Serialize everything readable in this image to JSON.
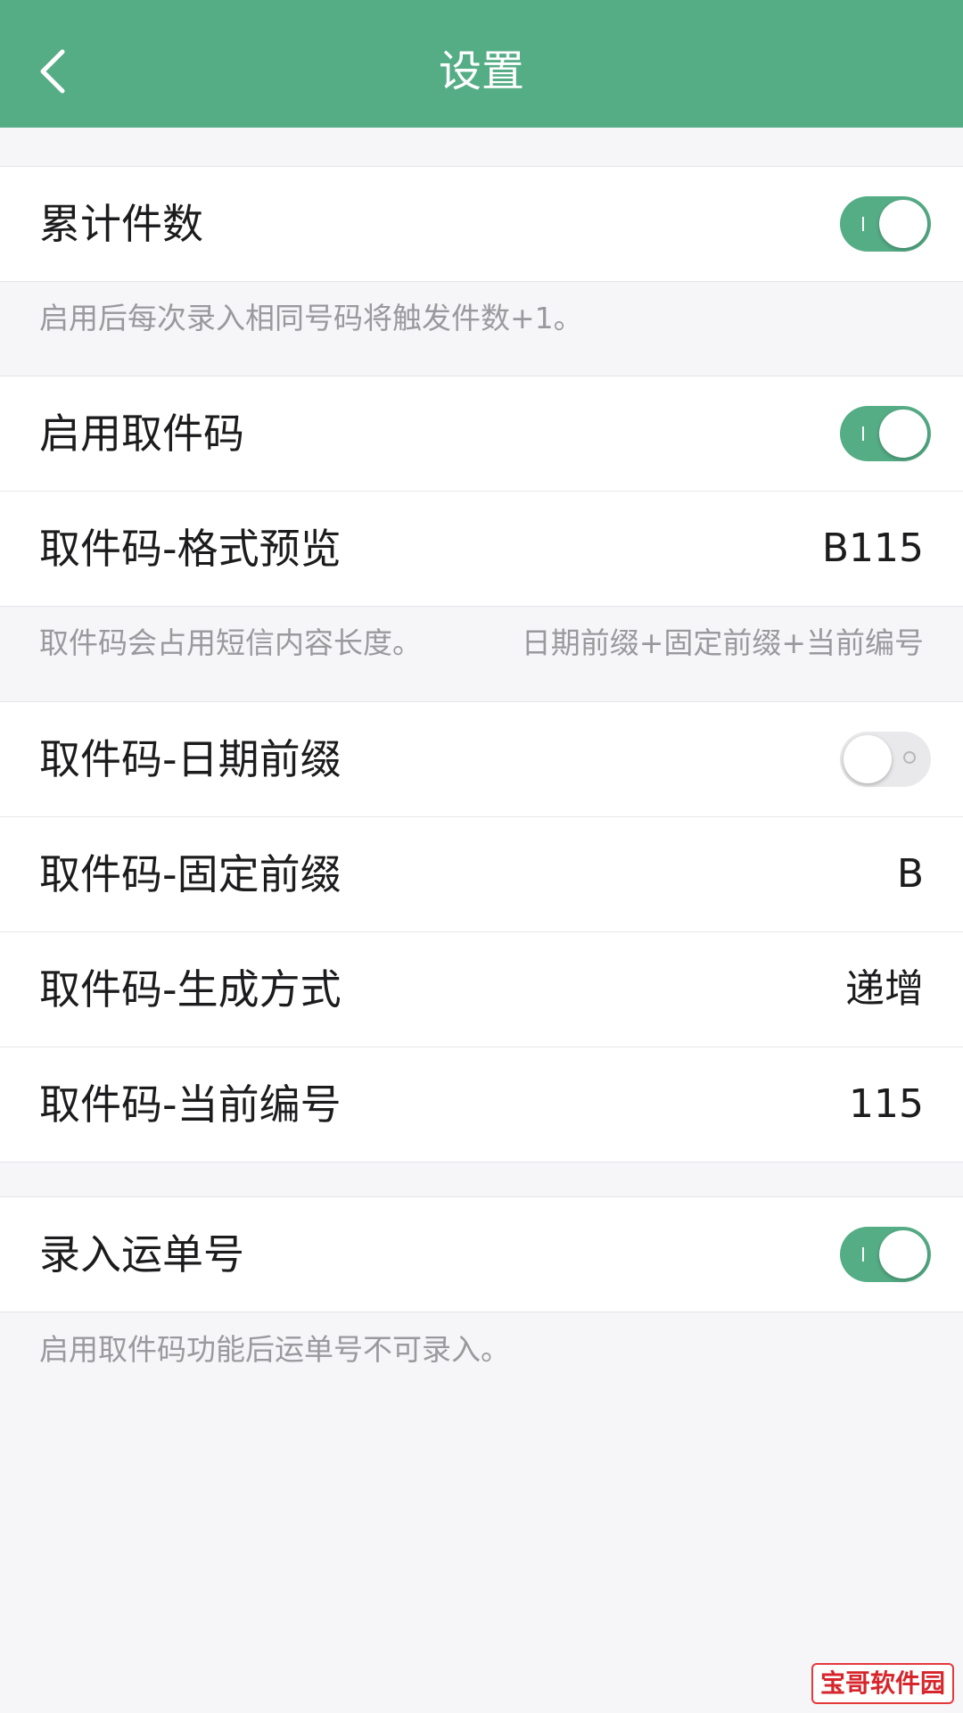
{
  "nav": {
    "title": "设置",
    "back_icon": "chevron-left-icon"
  },
  "colors": {
    "accent": "#55ad86",
    "background": "#f6f5f8",
    "toggle_off": "#e9e9eb",
    "footnote_text": "#9a9a9e"
  },
  "sections": {
    "count": {
      "label": "累计件数",
      "toggle_on": true,
      "note": "启用后每次录入相同号码将触发件数+1。"
    },
    "pickup": {
      "enable_label": "启用取件码",
      "enable_toggle_on": true,
      "preview_label": "取件码-格式预览",
      "preview_value": "B115",
      "note_left": "取件码会占用短信内容长度。",
      "note_right": "日期前缀+固定前缀+当前编号"
    },
    "pickup_settings": {
      "date_prefix_label": "取件码-日期前缀",
      "date_prefix_toggle_on": false,
      "fixed_prefix_label": "取件码-固定前缀",
      "fixed_prefix_value": "B",
      "generate_label": "取件码-生成方式",
      "generate_value": "递增",
      "current_label": "取件码-当前编号",
      "current_value": "115"
    },
    "waybill": {
      "label": "录入运单号",
      "toggle_on": true,
      "note": "启用取件码功能后运单号不可录入。"
    }
  },
  "watermark": "宝哥软件园"
}
